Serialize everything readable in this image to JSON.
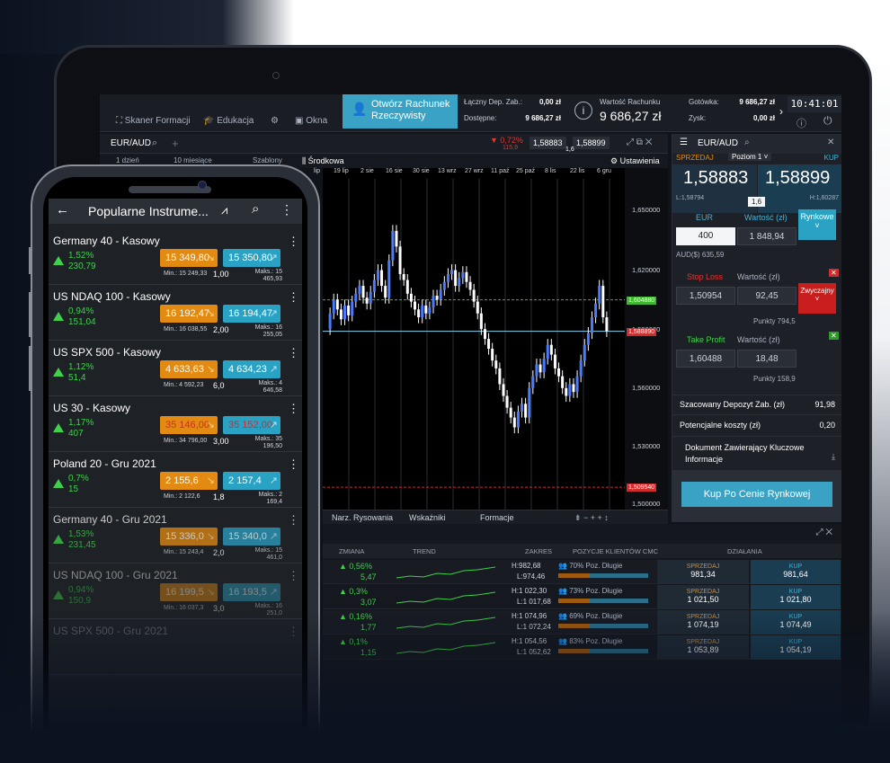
{
  "platform": {
    "toolbar": {
      "scanner": "Skaner Formacji",
      "education": "Edukacja",
      "window": "Okna",
      "open_account": "Otwórz Rachunek Rzeczywisty",
      "total_margin_label": "Łączny Dep. Zab.:",
      "total_margin": "0,00 zł",
      "available_label": "Dostępne:",
      "available": "9 686,27 zł",
      "account_value_label": "Wartość Rachunku",
      "account_value": "9 686,27 zł",
      "cash_label": "Gotówka:",
      "cash": "9 686,27 zł",
      "profit_label": "Zysk:",
      "profit": "0,00 zł",
      "clock": "10:41:01"
    },
    "chart": {
      "instrument": "EUR/AUD",
      "change_pct": "▼ 0,72%",
      "change_pts": "115,9",
      "sell": "1,58883",
      "buy": "1,58899",
      "spread": "1,6",
      "periods": "1 dzień",
      "range": "10 miesiące",
      "templates": "Szablony",
      "indicator": "Środkowa",
      "settings": "Ustawienia",
      "dates": [
        "lip",
        "19 lip",
        "2 sie",
        "16 sie",
        "30 sie",
        "13 wrz",
        "27 wrz",
        "11 paź",
        "25 paź",
        "8 lis",
        "22 lis",
        "6 gru"
      ],
      "y_ticks": [
        "1,650000",
        "1,620000",
        "1,590000",
        "1,560000",
        "1,530000",
        "1,500000"
      ],
      "tp_label": "1,604880",
      "price_label": "1,588890",
      "sl_label": "1,509540",
      "tools": [
        "Narz. Rysowania",
        "Wskaźniki",
        "Formacje"
      ]
    },
    "ticket": {
      "instrument": "EUR/AUD",
      "sell_label": "SPRZEDAJ",
      "level": "Poziom 1",
      "buy_label": "KUP",
      "sell_price": "1,58883",
      "buy_price": "1,58899",
      "low": "L:1,58794",
      "spread": "1,6",
      "high": "H:1,60287",
      "eur_label": "EUR",
      "value_label": "Wartość (zł)",
      "order_type": "Rynkowe",
      "quantity": "400",
      "value": "1 848,94",
      "aud_value": "AUD($) 635,59",
      "sl_label": "Stop Loss",
      "sl_value_label": "Wartość (zł)",
      "sl_price": "1,50954",
      "sl_value": "92,45",
      "sl_type": "Zwyczajny",
      "sl_points": "Punkty 794,5",
      "tp_label": "Take Profit",
      "tp_value_label": "Wartość (zł)",
      "tp_price": "1,60488",
      "tp_value": "18,48",
      "tp_points": "Punkty 158,9",
      "est_margin_label": "Szacowany Depozyt Zab. (zł)",
      "est_margin": "91,98",
      "costs_label": "Potencjalne koszty (zł)",
      "costs": "0,20",
      "doc_label": "Dokument Zawierający Kluczowe Informacje",
      "buy_button": "Kup Po Cenie Rynkowej"
    },
    "table": {
      "headers": [
        "ZMIANA",
        "TREND",
        "ZAKRES",
        "POZYCJE KLIENTÓW CMC",
        "DZIAŁANIA"
      ],
      "sell_label": "SPRZEDAJ",
      "buy_label": "KUP",
      "rows": [
        {
          "pct": "0,56%",
          "pts": "5,47",
          "high": "H:982,68",
          "low": "L:974,46",
          "clients": "70% Poz. Długie",
          "sell": "981,34",
          "buy": "981,64"
        },
        {
          "pct": "0,3%",
          "pts": "3,07",
          "high": "H:1 022,30",
          "low": "L:1 017,68",
          "clients": "73% Poz. Długie",
          "sell": "1 021,50",
          "buy": "1 021,80"
        },
        {
          "pct": "0,16%",
          "pts": "1,77",
          "high": "H:1 074,96",
          "low": "L:1 072,24",
          "clients": "69% Poz. Długie",
          "sell": "1 074,19",
          "buy": "1 074,49"
        },
        {
          "pct": "0,1%",
          "pts": "1,15",
          "high": "H:1 054,56",
          "low": "L:1 052,62",
          "clients": "83% Poz. Długie",
          "sell": "1 053,89",
          "buy": "1 054,19"
        }
      ]
    }
  },
  "phone": {
    "title": "Popularne Instrume...",
    "items": [
      {
        "name": "Germany 40 - Kasowy",
        "pct": "1,52%",
        "pts": "230,79",
        "sell": "15 349,80",
        "buy": "15 350,80",
        "min": "Min.: 15 249,33",
        "spread": "1,00",
        "max": "Maks.: 15 465,93"
      },
      {
        "name": "US NDAQ 100 - Kasowy",
        "pct": "0,94%",
        "pts": "151,04",
        "sell": "16 192,47",
        "buy": "16 194,47",
        "min": "Min.: 16 038,55",
        "spread": "2,00",
        "max": "Maks.: 16 255,05"
      },
      {
        "name": "US SPX 500 - Kasowy",
        "pct": "1,12%",
        "pts": "51,4",
        "sell": "4 633,63",
        "buy": "4 634,23",
        "min": "Min.: 4 592,23",
        "spread": "6,0",
        "max": "Maks.: 4 646,58"
      },
      {
        "name": "US 30 - Kasowy",
        "pct": "1,17%",
        "pts": "407",
        "sell": "35 146,00",
        "buy": "35 152,00",
        "min": "Min.: 34 796,00",
        "spread": "3,00",
        "max": "Maks.: 35 196,50"
      },
      {
        "name": "Poland 20 - Gru 2021",
        "pct": "0,7%",
        "pts": "15",
        "sell": "2 155,6",
        "buy": "2 157,4",
        "min": "Min.: 2 122,6",
        "spread": "1,8",
        "max": "Maks.: 2 169,4"
      },
      {
        "name": "Germany 40 - Gru 2021",
        "pct": "1,53%",
        "pts": "231,45",
        "sell": "15 336,0",
        "buy": "15 340,0",
        "min": "Min.: 15 243,4",
        "spread": "2,0",
        "max": "Maks.: 15 461,0"
      },
      {
        "name": "US NDAQ 100 - Gru 2021",
        "pct": "0,94%",
        "pts": "150,9",
        "sell": "16 199,5",
        "buy": "16 193,5",
        "min": "Min.: 16 037,3",
        "spread": "3,0",
        "max": "Maks.: 16 251,0"
      },
      {
        "name": "US SPX 500 - Gru 2021",
        "pct": "",
        "pts": "",
        "sell": "",
        "buy": "",
        "min": "",
        "spread": "",
        "max": ""
      }
    ]
  }
}
